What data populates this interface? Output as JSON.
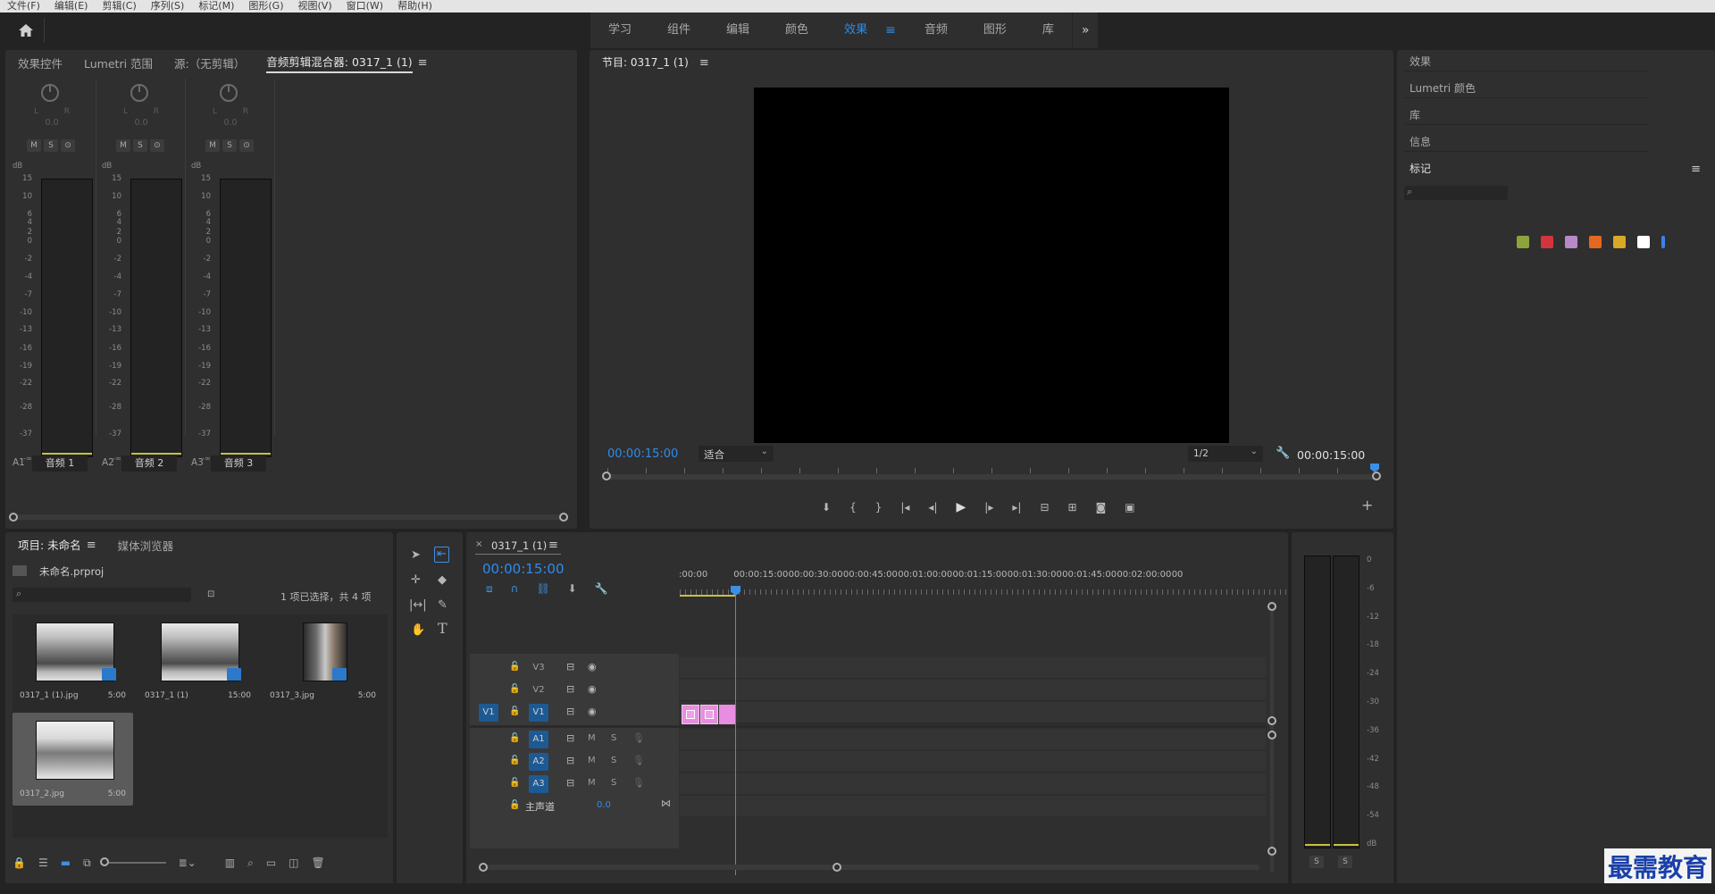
{
  "menu": [
    "文件(F)",
    "编辑(E)",
    "剪辑(C)",
    "序列(S)",
    "标记(M)",
    "图形(G)",
    "视图(V)",
    "窗口(W)",
    "帮助(H)"
  ],
  "workspaces": {
    "items": [
      "学习",
      "组件",
      "编辑",
      "颜色",
      "效果",
      "音频",
      "图形",
      "库"
    ],
    "active_index": 4,
    "more_glyph": "»"
  },
  "left_panel": {
    "tabs": [
      "效果控件",
      "Lumetri 范围",
      "源:（无剪辑）",
      "音频剪辑混合器: 0317_1 (1)"
    ],
    "active_tab": 3,
    "menu_glyph": "≡",
    "channels": [
      {
        "id": "A1",
        "name": "音频 1",
        "lr": [
          "L",
          "R"
        ],
        "volume": "0.0",
        "buttons": [
          "M",
          "S",
          "⊙"
        ]
      },
      {
        "id": "A2",
        "name": "音频 2",
        "lr": [
          "L",
          "R"
        ],
        "volume": "0.0",
        "buttons": [
          "M",
          "S",
          "⊙"
        ]
      },
      {
        "id": "A3",
        "name": "音频 3",
        "lr": [
          "L",
          "R"
        ],
        "volume": "0.0",
        "buttons": [
          "M",
          "S",
          "⊙"
        ]
      }
    ],
    "db_unit": "dB",
    "db_scale": [
      "15",
      "10",
      "6",
      "4",
      "2",
      "0",
      "-2",
      "-4",
      "-7",
      "-10",
      "-13",
      "-16",
      "-19",
      "-22",
      "-28",
      "-37",
      "-∞"
    ]
  },
  "program_monitor": {
    "title": "节目: 0317_1 (1)",
    "menu_glyph": "≡",
    "timecode_left": "00:00:15:00",
    "fit": "适合",
    "resolution": "1/2",
    "timecode_right": "00:00:15:00",
    "buttons": [
      "marker",
      "in",
      "out",
      "go-in",
      "step-back",
      "play",
      "step-forward",
      "go-out",
      "lift",
      "extract",
      "export-frame",
      "compare"
    ]
  },
  "right_panel": {
    "items": [
      "效果",
      "Lumetri 颜色",
      "库",
      "信息",
      "标记"
    ],
    "swatch_colors": [
      "#8da33c",
      "#d2353b",
      "#b58ac7",
      "#e4681f",
      "#d9a827",
      "#ffffff",
      "#3c82e6"
    ]
  },
  "project": {
    "tabs": [
      "项目: 未命名",
      "媒体浏览器"
    ],
    "file": "未命名.prproj",
    "selection_text": "1 项已选择，共 4 项",
    "items": [
      {
        "name": "0317_1 (1).jpg",
        "duration": "5:00"
      },
      {
        "name": "0317_1 (1)",
        "duration": "15:00"
      },
      {
        "name": "0317_3.jpg",
        "duration": "5:00"
      },
      {
        "name": "0317_2.jpg",
        "duration": "5:00"
      }
    ]
  },
  "timeline": {
    "tab": "0317_1 (1)",
    "close_glyph": "×",
    "menu_glyph": "≡",
    "timecode": "00:00:15:00",
    "ruler": [
      ":00:00",
      "00:00:15:00",
      "00:00:30:00",
      "00:00:45:00",
      "00:01:00:00",
      "00:01:15:00",
      "00:01:30:00",
      "00:01:45:00",
      "00:02:00:00",
      "00"
    ],
    "video_tracks": [
      "V3",
      "V2",
      "V1"
    ],
    "audio_tracks": [
      "A1",
      "A2",
      "A3"
    ],
    "source_patch_video": "V1",
    "audio_buttons": [
      "M",
      "S"
    ],
    "master_label": "主声道",
    "master_value": "0.0"
  },
  "audio_meter": {
    "scale": [
      "0",
      "-6",
      "-12",
      "-18",
      "-24",
      "-30",
      "-36",
      "-42",
      "-48",
      "-54",
      "dB"
    ],
    "solo": [
      "S",
      "S"
    ]
  },
  "watermark": "最需教育"
}
